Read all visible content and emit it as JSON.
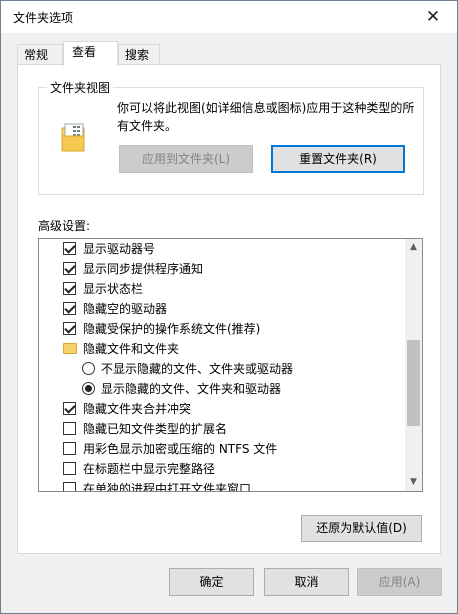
{
  "window": {
    "title": "文件夹选项",
    "close_glyph": "✕"
  },
  "tabs": [
    {
      "label": "常规"
    },
    {
      "label": "查看"
    },
    {
      "label": "搜索"
    }
  ],
  "folder_view": {
    "group_label": "文件夹视图",
    "description": "你可以将此视图(如详细信息或图标)应用于这种类型的所有文件夹。",
    "apply_button": "应用到文件夹(L)",
    "reset_button": "重置文件夹(R)"
  },
  "advanced": {
    "label": "高级设置:",
    "items": [
      {
        "type": "checkbox",
        "checked": true,
        "label": "显示驱动器号"
      },
      {
        "type": "checkbox",
        "checked": true,
        "label": "显示同步提供程序通知"
      },
      {
        "type": "checkbox",
        "checked": true,
        "label": "显示状态栏"
      },
      {
        "type": "checkbox",
        "checked": true,
        "label": "隐藏空的驱动器"
      },
      {
        "type": "checkbox",
        "checked": true,
        "label": "隐藏受保护的操作系统文件(推荐)"
      },
      {
        "type": "folder",
        "label": "隐藏文件和文件夹"
      },
      {
        "type": "radio",
        "checked": false,
        "label": "不显示隐藏的文件、文件夹或驱动器"
      },
      {
        "type": "radio",
        "checked": true,
        "label": "显示隐藏的文件、文件夹和驱动器"
      },
      {
        "type": "checkbox",
        "checked": true,
        "label": "隐藏文件夹合并冲突"
      },
      {
        "type": "checkbox",
        "checked": false,
        "label": "隐藏已知文件类型的扩展名"
      },
      {
        "type": "checkbox",
        "checked": false,
        "label": "用彩色显示加密或压缩的 NTFS 文件"
      },
      {
        "type": "checkbox",
        "checked": false,
        "label": "在标题栏中显示完整路径"
      },
      {
        "type": "checkbox",
        "checked": false,
        "label": "在单独的进程中打开文件夹窗口"
      }
    ],
    "restore_button": "还原为默认值(D)"
  },
  "footer": {
    "ok_button": "确定",
    "cancel_button": "取消",
    "apply_button": "应用(A)"
  }
}
